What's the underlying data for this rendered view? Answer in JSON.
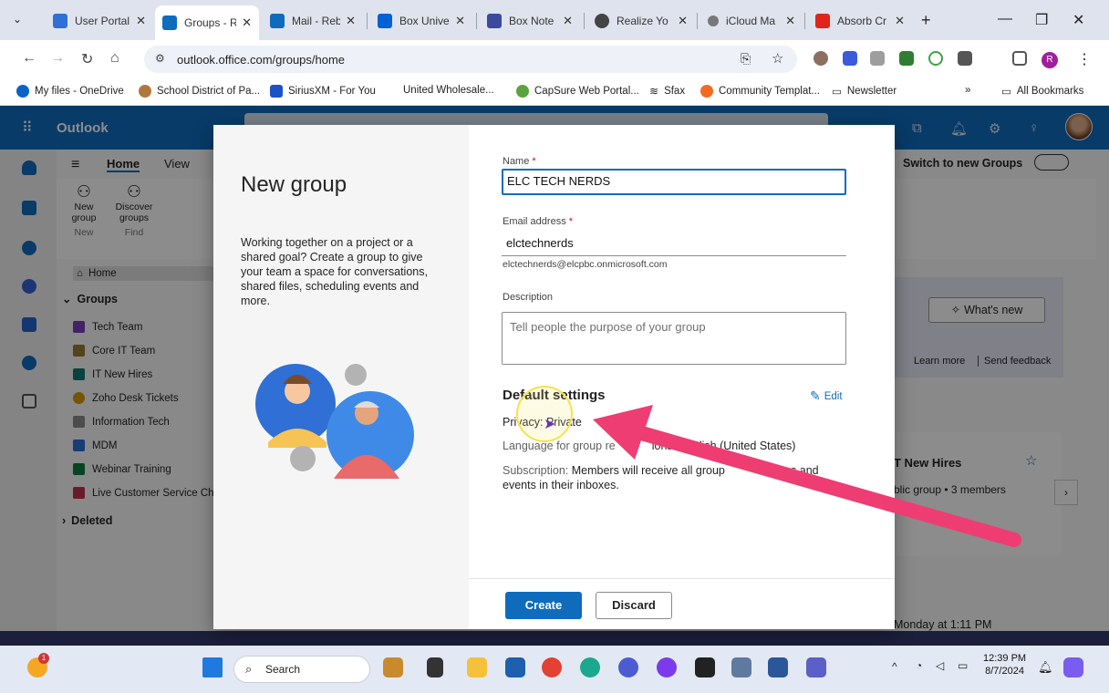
{
  "browser": {
    "tabs": [
      {
        "title": "User Portal",
        "color": "#2f6fd6"
      },
      {
        "title": "Groups - R",
        "color": "#0f6cbd",
        "active": true
      },
      {
        "title": "Mail - Reb",
        "color": "#0f6cbd"
      },
      {
        "title": "Box Univer",
        "color": "#0061d5"
      },
      {
        "title": "Box Note",
        "color": "#0061d5"
      },
      {
        "title": "Realize Yo",
        "color": "#444"
      },
      {
        "title": "iCloud Ma",
        "color": "#777"
      },
      {
        "title": "Absorb Cr",
        "color": "#e1251b"
      }
    ],
    "url": "outlook.office.com/groups/home",
    "profile_initial": "R",
    "bookmarks": [
      "My files - OneDrive",
      "School District of Pa...",
      "SiriusXM - For You",
      "United Wholesale...",
      "CapSure Web Portal...",
      "Sfax",
      "Community Templat...",
      "Newsletter"
    ],
    "bookmarks_overflow": "»",
    "all_bookmarks": "All Bookmarks"
  },
  "outlook": {
    "app_name": "Outlook",
    "ribbon_tabs": [
      "Home",
      "View"
    ],
    "switch_label": "Switch to new Groups",
    "ribbon_buttons": [
      {
        "label": "New group",
        "sub": "New"
      },
      {
        "label": "Discover groups",
        "sub": "Find"
      }
    ],
    "home_label": "Home",
    "groups_label": "Groups",
    "groups": [
      {
        "name": "Tech Team",
        "color": "#7a3fbf"
      },
      {
        "name": "Core IT Team",
        "color": "#9a7a33"
      },
      {
        "name": "IT New Hires",
        "color": "#107c6f"
      },
      {
        "name": "Zoho Desk Tickets",
        "color": "#d69b00"
      },
      {
        "name": "Information Tech",
        "color": "#8a8a8a"
      },
      {
        "name": "MDM",
        "color": "#2d6fd6"
      },
      {
        "name": "Webinar Training",
        "color": "#107c41"
      },
      {
        "name": "Live Customer Service Chat",
        "color": "#c4314b"
      }
    ],
    "deleted_label": "Deleted",
    "whats_new": "What's new",
    "learn_more": "Learn more",
    "send_feedback": "Send feedback",
    "card_title": "T New Hires",
    "card_sub": "blic group • 3 members",
    "timestamp": "Monday at 1:11 PM"
  },
  "dialog": {
    "title": "New group",
    "description": "Working together on a project or a shared goal? Create a group to give your team a space for conversations, shared files, scheduling events and more.",
    "name_label": "Name",
    "name_value": "ELC TECH NERDS",
    "email_label": "Email address",
    "email_value": "elctechnerds",
    "email_full": "elctechnerds@elcpbc.onmicrosoft.com",
    "description_label": "Description",
    "description_placeholder": "Tell people the purpose of your group",
    "settings_title": "Default settings",
    "edit_label": "Edit",
    "privacy_key": "Privacy:",
    "privacy_value": "Private",
    "language_key": "Language for group re",
    "language_value": "ions: English (United States)",
    "subscription_key": "Subscription:",
    "subscription_value": "Members will receive all group",
    "subscription_value_2": "tions and events in their inboxes.",
    "create_label": "Create",
    "discard_label": "Discard"
  },
  "taskbar": {
    "search_placeholder": "Search",
    "time": "12:39 PM",
    "date": "8/7/2024"
  }
}
